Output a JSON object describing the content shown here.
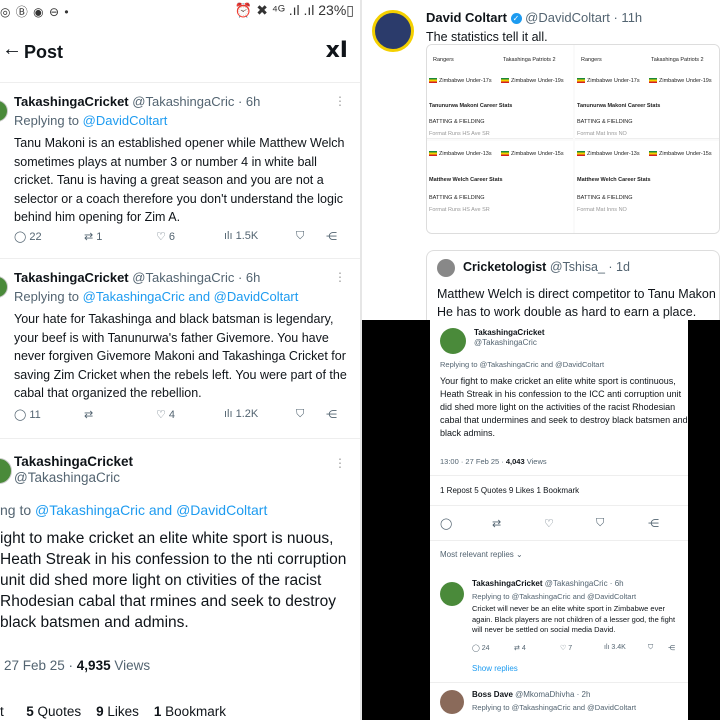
{
  "left": {
    "status": {
      "icons": "◎ Ⓑ ◉ ⊖ •",
      "right": "⏰ ✖ ⁴ᴳ .ıl .ıl 23%▯"
    },
    "header": {
      "back": "←",
      "title": "Post",
      "logo": "xI"
    },
    "tweet1": {
      "name": "TakashingaCricket",
      "handle": "@TakashingaCric · 6h",
      "replying": "Replying to",
      "replying_to": "@DavidColtart",
      "body": "Tanu Makoni is an established opener while Matthew Welch sometimes plays at number 3 or number 4 in white ball cricket. Tanu is having a great season and you are not a selector or a coach therefore you don't understand the logic behind him opening for Zim A.",
      "replies": "22",
      "reposts": "1",
      "likes": "6",
      "views": "1.5K"
    },
    "tweet2": {
      "name": "TakashingaCricket",
      "handle": "@TakashingaCric · 6h",
      "replying": "Replying to",
      "replying_to": "@TakashingaCric and @DavidColtart",
      "body": "Your hate for Takashinga and black batsman is legendary, your beef is with Tanunurwa's father Givemore. You have never forgiven Givemore Makoni and Takashinga Cricket for saving Zim Cricket when the rebels left. You were part of the cabal that organized the rebellion.",
      "replies": "11",
      "reposts": "",
      "likes": "4",
      "views": "1.2K"
    },
    "tweet3": {
      "name": "TakashingaCricket",
      "handle": "@TakashingaCric",
      "replying": "ng to",
      "replying_to": "@TakashingaCric and @DavidColtart",
      "body": "ight to make cricket an elite white sport is nuous, Heath Streak in his confession to the nti corruption unit did shed more light on ctivities of the racist Rhodesian cabal that rmines and seek to destroy black batsmen and admins.",
      "meta": "27 Feb 25 · ",
      "views_count": "4,935",
      "views_label": " Views",
      "quotes": "5",
      "quotes_label": " Quotes",
      "likes": "9",
      "likes_label": " Likes",
      "bookmarks": "1",
      "bookmarks_label": " Bookmark",
      "reposts_tail": "t"
    }
  },
  "topright": {
    "name": "David Coltart",
    "handle": "@DavidColtart · 11h",
    "text": "The statistics tell it all.",
    "stats": {
      "team1": "Rangers",
      "team2": "Takashinga Patriots 2",
      "zim17": "Zimbabwe Under-17s",
      "zim19": "Zimbabwe Under-19s",
      "zim13": "Zimbabwe Under-13s",
      "zim15": "Zimbabwe Under-15s",
      "career1": "Tanunurwa Makoni Career Stats",
      "career2": "Matthew Welch Career Stats",
      "batting": "BATTING & FIELDING",
      "cols": "Format     Runs     HS     Ave     SR",
      "cols2": "Format     Mat     Inns     NO"
    },
    "quote": {
      "name": "Cricketologist",
      "handle": "@Tshisa_ · 1d",
      "text": "Matthew Welch is direct competitor to Tanu Makon He has to work double as hard to earn a place."
    }
  },
  "bottomright": {
    "name": "TakashingaCricket",
    "handle": "@TakashingaCric",
    "replying": "Replying to @TakashingaCric and @DavidColtart",
    "body": "Your fight to make cricket an elite white sport is continuous, Heath Streak in his confession to the ICC anti corruption unit did shed more light on the activities of the racist Rhodesian cabal that undermines and seek to destroy black batsmen and black admins.",
    "meta": "13:00 · 27 Feb 25 · ",
    "views": "4,043",
    "views_label": " Views",
    "stats": "1 Repost   5 Quotes   9 Likes   1 Bookmark",
    "most_relevant": "Most relevant replies ⌄",
    "reply1": {
      "name": "TakashingaCricket",
      "handle": " @TakashingaCric · 6h",
      "replying": "Replying to @TakashingaCric and @DavidColtart",
      "body": "Cricket will never be an elite white sport in Zimbabwe ever again. Black players are not children of a lesser god, the fight will never be settled on social media David.",
      "replies": "24",
      "reposts": "4",
      "likes": "7",
      "views": "3.4K"
    },
    "show_replies": "Show replies",
    "reply2": {
      "name": "Boss Dave",
      "handle": " @MkomaDhivha · 2h",
      "replying": "Replying to @TakashingaCric and @DavidColtart"
    }
  },
  "colors": {
    "link": "#1d9bf0",
    "text": "#0f1419",
    "muted": "#536471"
  },
  "icons": [
    "back-arrow-icon",
    "grok-icon",
    "reply-icon",
    "repost-icon",
    "like-icon",
    "views-icon",
    "bookmark-icon",
    "share-icon",
    "verified-icon"
  ]
}
